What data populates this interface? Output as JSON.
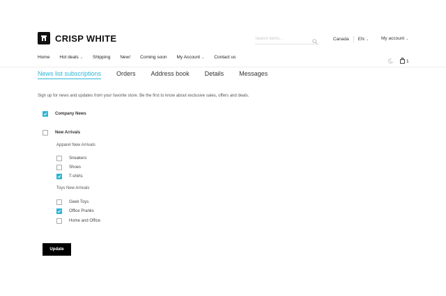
{
  "brand": {
    "name": "CRISP WHITE",
    "logo_icon": "crisp-white-logo"
  },
  "search": {
    "placeholder": "Search items...",
    "icon": "search-icon"
  },
  "header": {
    "country": "Canada",
    "language": "EN",
    "account": "My account"
  },
  "nav": {
    "items": [
      {
        "label": "Home",
        "dropdown": false
      },
      {
        "label": "Hot deals",
        "dropdown": true
      },
      {
        "label": "Shipping",
        "dropdown": false
      },
      {
        "label": "New!",
        "dropdown": false
      },
      {
        "label": "Coming soon",
        "dropdown": false
      },
      {
        "label": "My Account",
        "dropdown": true
      },
      {
        "label": "Contact us",
        "dropdown": false
      }
    ],
    "cart_count": "1"
  },
  "tabs": [
    {
      "label": "News list subscriptions",
      "active": true
    },
    {
      "label": "Orders",
      "active": false
    },
    {
      "label": "Address book",
      "active": false
    },
    {
      "label": "Details",
      "active": false
    },
    {
      "label": "Messages",
      "active": false
    }
  ],
  "intro": "Sign up for news and updates from your favorite store. Be the first to know about exclusive sales, offers and deals.",
  "subscriptions": {
    "company_news": {
      "label": "Company News",
      "checked": true
    },
    "new_arrivals": {
      "label": "New Arrivals",
      "checked": false
    },
    "apparel": {
      "label": "Apparel New Arrivals",
      "items": [
        {
          "label": "Sneakers",
          "checked": false
        },
        {
          "label": "Shoes",
          "checked": false
        },
        {
          "label": "T-shirts",
          "checked": true
        }
      ]
    },
    "toys": {
      "label": "Toys New Arrivals",
      "items": [
        {
          "label": "Geek Toys",
          "checked": false
        },
        {
          "label": "Office Pranks",
          "checked": true
        },
        {
          "label": "Home and Office",
          "checked": false
        }
      ]
    }
  },
  "update_label": "Update",
  "colors": {
    "accent": "#2bb5d6",
    "button": "#000000"
  }
}
